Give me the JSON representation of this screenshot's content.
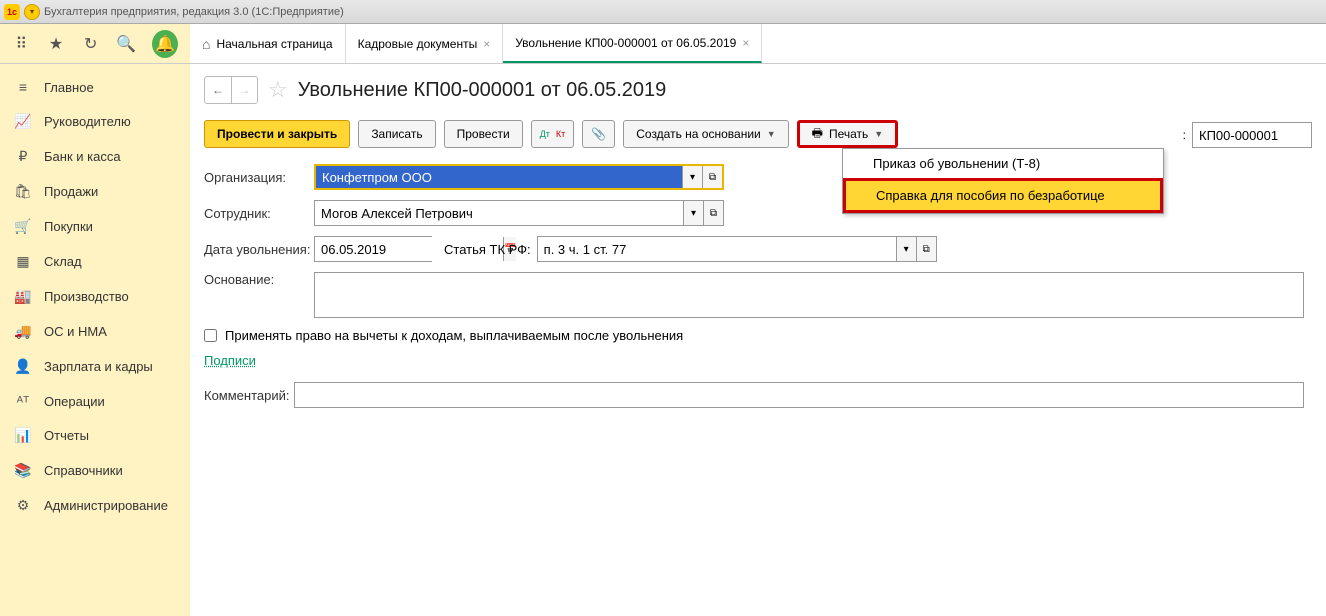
{
  "titlebar": {
    "title": "Бухгалтерия предприятия, редакция 3.0  (1С:Предприятие)"
  },
  "tabs": {
    "home": "Начальная страница",
    "t1": "Кадровые документы",
    "t2": "Увольнение КП00-000001 от 06.05.2019"
  },
  "sidebar": {
    "items": [
      {
        "icon": "≡",
        "label": "Главное"
      },
      {
        "icon": "📈",
        "label": "Руководителю"
      },
      {
        "icon": "₽",
        "label": "Банк и касса"
      },
      {
        "icon": "🛍",
        "label": "Продажи"
      },
      {
        "icon": "🛒",
        "label": "Покупки"
      },
      {
        "icon": "▦",
        "label": "Склад"
      },
      {
        "icon": "🏭",
        "label": "Производство"
      },
      {
        "icon": "🚚",
        "label": "ОС и НМА"
      },
      {
        "icon": "👤",
        "label": "Зарплата и кадры"
      },
      {
        "icon": "ᴬᵀ",
        "label": "Операции"
      },
      {
        "icon": "📊",
        "label": "Отчеты"
      },
      {
        "icon": "📚",
        "label": "Справочники"
      },
      {
        "icon": "⚙",
        "label": "Администрирование"
      }
    ]
  },
  "doc": {
    "title": "Увольнение КП00-000001 от 06.05.2019",
    "number": "КП00-000001"
  },
  "actions": {
    "post_close": "Провести и закрыть",
    "write": "Записать",
    "post": "Провести",
    "dtkt": "Дт Кт",
    "attach": "📎",
    "create_based": "Создать на основании",
    "print": "Печать"
  },
  "print_menu": {
    "i1": "Приказ об увольнении (Т-8)",
    "i2": "Справка для пособия по безработице"
  },
  "form": {
    "org_label": "Организация:",
    "org_value": "Конфетпром ООО",
    "emp_label": "Сотрудник:",
    "emp_value": "Могов Алексей Петрович",
    "date_label": "Дата увольнения:",
    "date_value": "06.05.2019",
    "tk_label": "Статья ТК РФ:",
    "tk_value": "п. 3 ч. 1 ст. 77",
    "basis_label": "Основание:",
    "deduct_label": "Применять право на вычеты к доходам, выплачиваемым после увольнения",
    "sign_link": "Подписи",
    "comment_label": "Комментарий:"
  }
}
